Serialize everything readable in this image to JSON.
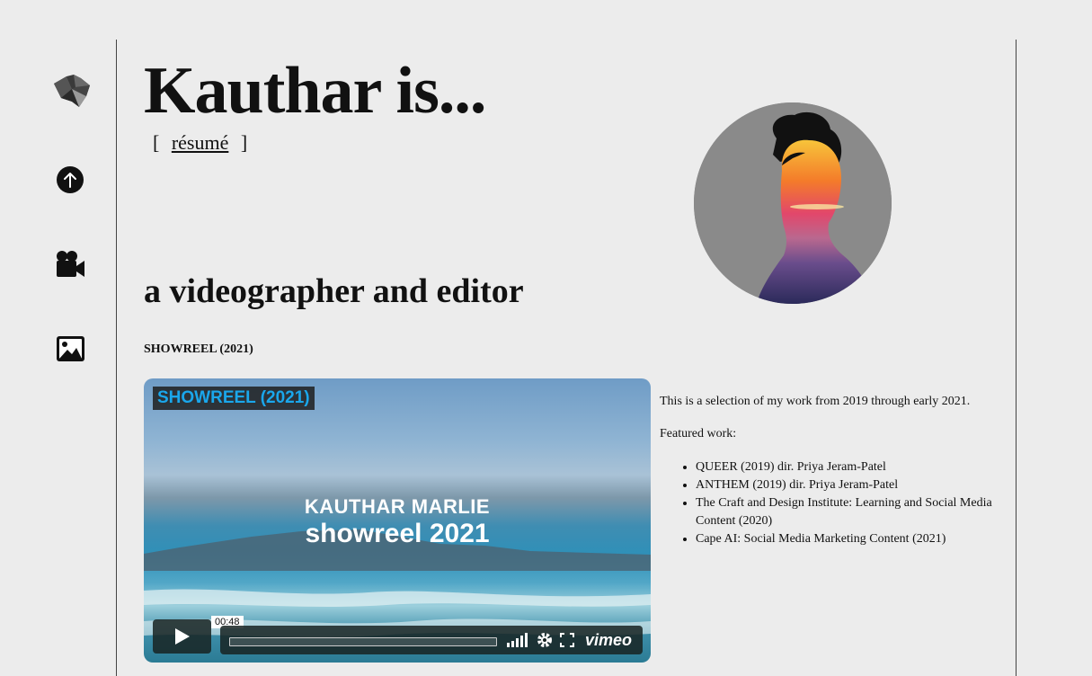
{
  "page": {
    "title": "Kauthar is...",
    "resume_open": "[",
    "resume_link": "résumé",
    "resume_close": "]",
    "subtitle": "a videographer and editor",
    "reel_heading": "SHOWREEL (2021)"
  },
  "nav": {
    "items": [
      {
        "name": "logo",
        "icon": "geometric-logo-icon"
      },
      {
        "name": "back-to-top",
        "icon": "arrow-up-circle-icon"
      },
      {
        "name": "video",
        "icon": "video-camera-icon"
      },
      {
        "name": "photos",
        "icon": "image-icon"
      }
    ]
  },
  "video": {
    "label": "SHOWREEL (2021)",
    "overlay_name": "KAUTHAR MARLIE",
    "overlay_title": "showreel 2021",
    "time": "00:48",
    "brand": "vimeo",
    "progress": 0
  },
  "description": {
    "intro": "This is a selection of my work from 2019 through early 2021.",
    "featured_label": "Featured work:",
    "items": [
      "QUEER (2019) dir. Priya Jeram-Patel",
      "ANTHEM (2019) dir. Priya Jeram-Patel",
      "The Craft and Design Institute: Learning and Social Media Content (2020)",
      "Cape AI: Social Media Marketing Content (2021)"
    ]
  },
  "colors": {
    "background": "#ececec",
    "video_label_text": "#1aa7ec",
    "controls_bg": "#172322"
  }
}
